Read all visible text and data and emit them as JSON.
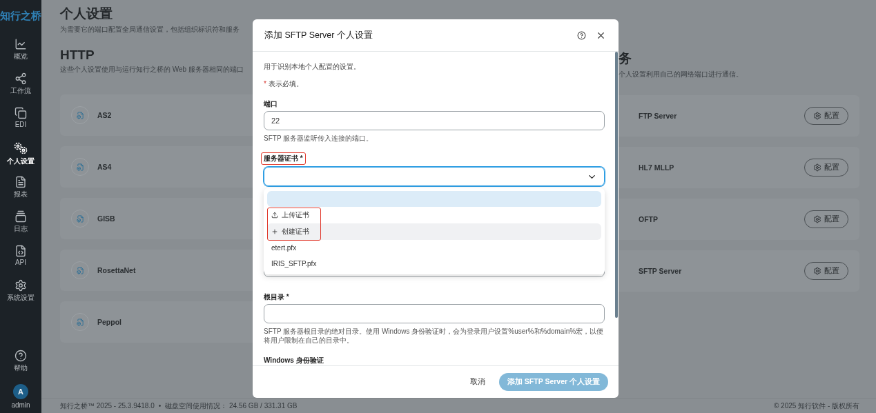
{
  "sidebar": {
    "logo": "知行之桥",
    "items": [
      {
        "label": "概览",
        "selected": false
      },
      {
        "label": "工作流",
        "selected": false
      },
      {
        "label": "EDI",
        "selected": false
      },
      {
        "label": "个人设置",
        "selected": true
      },
      {
        "label": "报表",
        "selected": false
      },
      {
        "label": "日志",
        "selected": false
      },
      {
        "label": "API",
        "selected": false
      },
      {
        "label": "系统设置",
        "selected": false
      }
    ],
    "help": "帮助",
    "user": {
      "initial": "A",
      "name": "admin"
    }
  },
  "page": {
    "title": "个人设置",
    "subtitle": "为需要它的端口配置全局通信设置，包括组织标识符和服务"
  },
  "http_section": {
    "title": "HTTP",
    "subtitle": "这些个人设置使用与运行知行之桥的 Web 服务器相同的端口",
    "items": [
      {
        "name": "AS2"
      },
      {
        "name": "AS4"
      },
      {
        "name": "GISB"
      },
      {
        "name": "RosettaNet"
      },
      {
        "name": "Peppol"
      }
    ]
  },
  "port_section": {
    "title": "务",
    "subtitle": "个人设置利用自己的网络端口进行通信。",
    "items": [
      {
        "name": "FTP Server",
        "button": "配置"
      },
      {
        "name": "HL7 MLLP",
        "button": "配置"
      },
      {
        "name": "OFTP",
        "button": "配置"
      },
      {
        "name": "SFTP Server",
        "button": "配置"
      }
    ]
  },
  "footer": {
    "version": "知行之桥™ 2025 - 25.3.9418.0",
    "separator": "•",
    "disk": "磁盘空间使用情况： 24.56 GB / 331.31 GB",
    "copyright": "© 2025 知行软件 - 版权所有"
  },
  "dialog": {
    "title": "添加 SFTP Server 个人设置",
    "intro": "用于识别本地个人配置的设置。",
    "required_mark": "*",
    "required_note": "表示必填。",
    "fields": [
      {
        "kind": "input",
        "label": "端口",
        "required": false,
        "value": "22",
        "hint": "SFTP 服务器监听传入连接的端口。"
      },
      {
        "kind": "select",
        "label": "服务器证书",
        "required": true,
        "label_highlighted": true,
        "focused": true,
        "expanded": true,
        "actions_highlighted": true,
        "options": [
          {
            "kind": "blank",
            "selected": true,
            "hovered": false
          },
          {
            "kind": "upload",
            "label": "上传证书",
            "selected": false,
            "hovered": false
          },
          {
            "kind": "create",
            "label": "创建证书",
            "selected": false,
            "hovered": true
          },
          {
            "kind": "file",
            "label": "etert.pfx",
            "selected": false,
            "hovered": false
          },
          {
            "kind": "file",
            "label": "IRIS_SFTP.pfx",
            "selected": false,
            "hovered": false
          }
        ]
      },
      {
        "kind": "input"
      },
      {
        "kind": "input",
        "label": "根目录",
        "required": true,
        "hint": "SFTP 服务器根目录的绝对目录。使用 Windows 身份验证时，会为登录用户设置%user%和%domain%宏，以便将用户限制在自己的目录中。"
      },
      {
        "kind": "heading",
        "label": "Windows 身份验证"
      }
    ],
    "cancel": "取消",
    "submit": {
      "label": "添加 SFTP Server 个人设置",
      "disabled": true
    }
  }
}
